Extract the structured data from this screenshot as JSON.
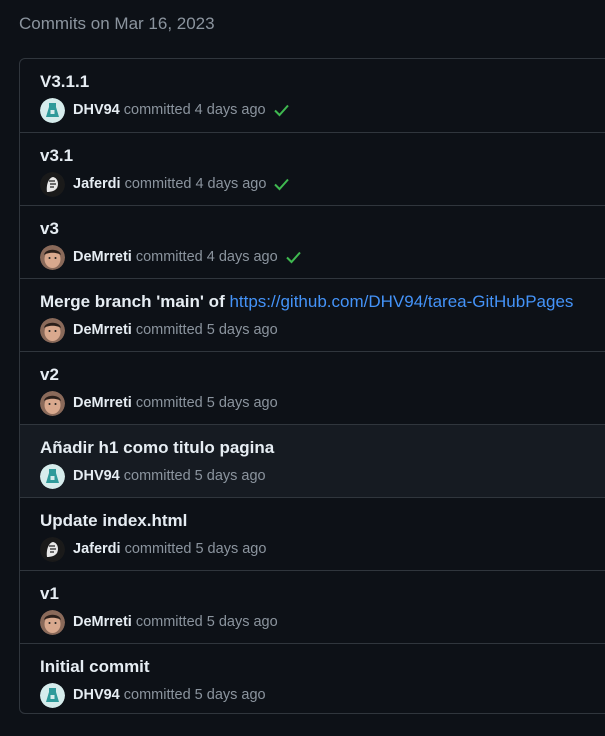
{
  "group_title": "Commits on Mar 16, 2023",
  "colors": {
    "background": "#0d1117",
    "border": "#30363d",
    "muted": "#8b949e",
    "text": "#e6edf3",
    "link": "#4493f8",
    "success": "#3fb950"
  },
  "commits": [
    {
      "message": "V3.1.1",
      "author": "DHV94",
      "avatar": "dhv94-avatar",
      "time": "committed 4 days ago",
      "status": "success-check-icon"
    },
    {
      "message": "v3.1",
      "author": "Jaferdi",
      "avatar": "jaferdi-avatar",
      "time": "committed 4 days ago",
      "status": "success-check-icon"
    },
    {
      "message": "v3",
      "author": "DeMrreti",
      "avatar": "demrreti-avatar",
      "time": "committed 4 days ago",
      "status": "success-check-icon"
    },
    {
      "message": "Merge branch 'main' of ",
      "link": "https://github.com/DHV94/tarea-GitHubPages",
      "author": "DeMrreti",
      "avatar": "demrreti-avatar",
      "time": "committed 5 days ago"
    },
    {
      "message": "v2",
      "author": "DeMrreti",
      "avatar": "demrreti-avatar",
      "time": "committed 5 days ago"
    },
    {
      "message": "Añadir h1 como titulo pagina",
      "author": "DHV94",
      "avatar": "dhv94-avatar",
      "time": "committed 5 days ago"
    },
    {
      "message": "Update index.html",
      "author": "Jaferdi",
      "avatar": "jaferdi-avatar",
      "time": "committed 5 days ago"
    },
    {
      "message": "v1",
      "author": "DeMrreti",
      "avatar": "demrreti-avatar",
      "time": "committed 5 days ago"
    },
    {
      "message": "Initial commit",
      "author": "DHV94",
      "avatar": "dhv94-avatar",
      "time": "committed 5 days ago"
    }
  ]
}
